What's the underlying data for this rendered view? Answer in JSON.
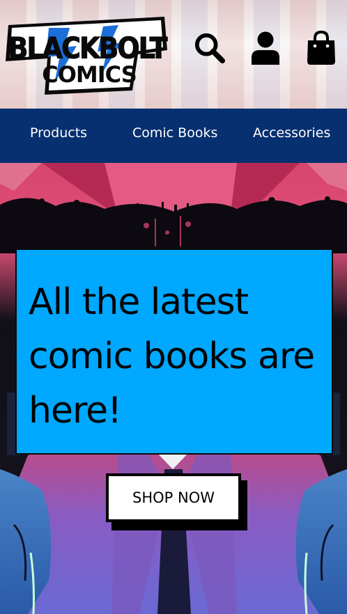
{
  "brand": {
    "logo_line1": "BLACKBOLT",
    "logo_line2": "COMICS",
    "colors": {
      "accent": "#00a8ff",
      "nav": "#073070"
    }
  },
  "header": {
    "icons": [
      "search-icon",
      "account-icon",
      "shopping-bag-icon"
    ]
  },
  "nav": {
    "items": [
      {
        "label": "Products"
      },
      {
        "label": "Comic Books"
      },
      {
        "label": "Accessories"
      }
    ]
  },
  "hero": {
    "headline": "All the latest comic books are here!",
    "cta_label": "SHOP NOW"
  }
}
